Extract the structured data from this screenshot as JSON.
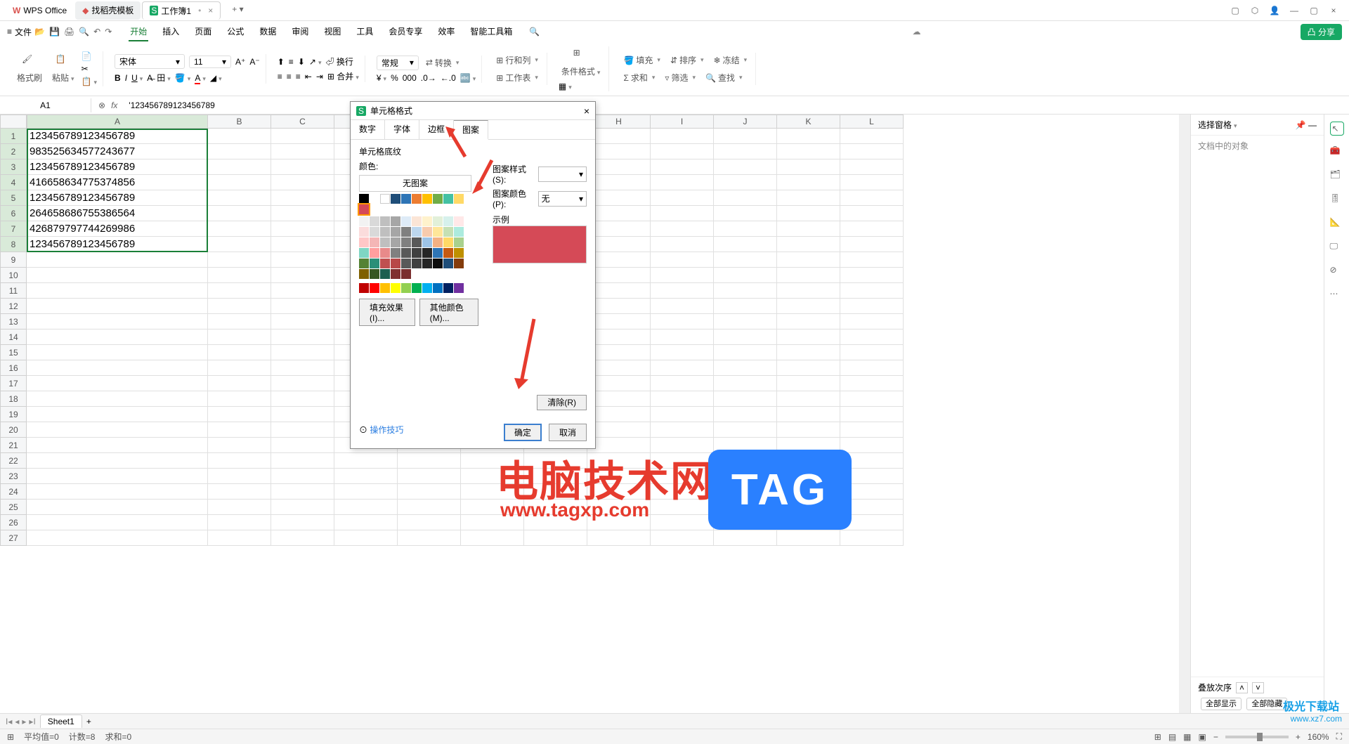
{
  "titlebar": {
    "tabs": [
      "WPS Office",
      "找稻壳模板",
      "工作簿1"
    ],
    "add": "+"
  },
  "menubar": {
    "file": "文件",
    "items": [
      "开始",
      "插入",
      "页面",
      "公式",
      "数据",
      "审阅",
      "视图",
      "工具",
      "会员专享",
      "效率",
      "智能工具箱"
    ],
    "active": "开始",
    "share": "分享"
  },
  "ribbon": {
    "formatBrush": "格式刷",
    "paste": "粘贴",
    "fontName": "宋体",
    "fontSize": "11",
    "numberFmt": "常规",
    "convert": "转换",
    "rowCol": "行和列",
    "worksheet": "工作表",
    "condFmt": "条件格式",
    "fill": "填充",
    "sort": "排序",
    "freeze": "冻结",
    "sum": "求和",
    "filter": "筛选",
    "find": "查找",
    "wrap": "换行",
    "merge": "合并"
  },
  "formula": {
    "nameBox": "A1",
    "fx": "fx",
    "value": "'123456789123456789"
  },
  "grid": {
    "colWidths": {
      "A": 258,
      "others": 90
    },
    "cols": [
      "A",
      "B",
      "C",
      "D",
      "E",
      "F",
      "G",
      "H",
      "I",
      "J",
      "K",
      "L"
    ],
    "rows": [
      "1",
      "2",
      "3",
      "4",
      "5",
      "6",
      "7",
      "8",
      "9",
      "10",
      "11",
      "12",
      "13",
      "14",
      "15",
      "16",
      "17",
      "18",
      "19",
      "20",
      "21",
      "22",
      "23",
      "24",
      "25",
      "26",
      "27"
    ],
    "data": {
      "1": "123456789123456789",
      "2": "983525634577243677",
      "3": "123456789123456789",
      "4": "416658634775374856",
      "5": "123456789123456789",
      "6": "264658686755386564",
      "7": "426879797744269986",
      "8": "123456789123456789"
    }
  },
  "sidepanel": {
    "title": "选择窗格",
    "sub": "文档中的对象",
    "order": "叠放次序",
    "showAll": "全部显示",
    "hideAll": "全部隐藏"
  },
  "dialog": {
    "title": "单元格格式",
    "tabs": [
      "数字",
      "字体",
      "边框",
      "图案"
    ],
    "activeTab": "图案",
    "section": "单元格底纹",
    "colorLbl": "颜色:",
    "noPattern": "无图案",
    "patternStyle": "图案样式(S):",
    "patternColor": "图案颜色(P):",
    "none": "无",
    "example": "示例",
    "fillEffect": "填充效果(I)...",
    "moreColor": "其他颜色(M)...",
    "clear": "清除(R)",
    "tips": "操作技巧",
    "ok": "确定",
    "cancel": "取消",
    "paletteRow1": [
      "#000000",
      "#ffffff",
      "",
      "#1f4e79",
      "#2e75b6",
      "#ed7d31",
      "#ffc000",
      "#70ad47",
      "#44c1a3",
      "#ffd966",
      "#d54a57"
    ],
    "paletteShades": [
      [
        "#f2f2f2",
        "#d9d9d9",
        "#bfbfbf",
        "#a6a6a6",
        "#deebf7",
        "#fbe5d6",
        "#fff2cc",
        "#e2f0d9",
        "#d6f1ec",
        "#ffe8e8",
        "#fbdcdc"
      ],
      [
        "#d9d9d9",
        "#bfbfbf",
        "#a6a6a6",
        "#808080",
        "#bdd7ee",
        "#f8cbad",
        "#ffe699",
        "#c5e0b4",
        "#acebde",
        "#ffc7c7",
        "#f4b6b6"
      ],
      [
        "#bfbfbf",
        "#a6a6a6",
        "#808080",
        "#595959",
        "#9dc3e6",
        "#f4b183",
        "#ffd966",
        "#a9d18e",
        "#7fd6c3",
        "#ff9f9f",
        "#e88a8a"
      ],
      [
        "#808080",
        "#595959",
        "#404040",
        "#262626",
        "#2e75b6",
        "#c55a11",
        "#bf9000",
        "#548235",
        "#2a8f78",
        "#c05050",
        "#b84848"
      ],
      [
        "#595959",
        "#404040",
        "#262626",
        "#0d0d0d",
        "#1f4e79",
        "#843c0c",
        "#7f6000",
        "#385723",
        "#1c5f50",
        "#803030",
        "#7a2e2e"
      ]
    ],
    "paletteStd": [
      "#c00000",
      "#ff0000",
      "#ffc000",
      "#ffff00",
      "#92d050",
      "#00b050",
      "#00b0f0",
      "#0070c0",
      "#002060",
      "#7030a0"
    ]
  },
  "sheetTabs": {
    "sheet": "Sheet1",
    "add": "+"
  },
  "statusbar": {
    "avg": "平均值=0",
    "count": "计数=8",
    "sum": "求和=0",
    "zoom": "160%"
  },
  "watermark": {
    "wm1": "电脑技术网",
    "wm1url": "www.tagxp.com",
    "wm2": "TAG",
    "wm3": "极光下载站",
    "wm3sub": "www.xz7.com"
  }
}
